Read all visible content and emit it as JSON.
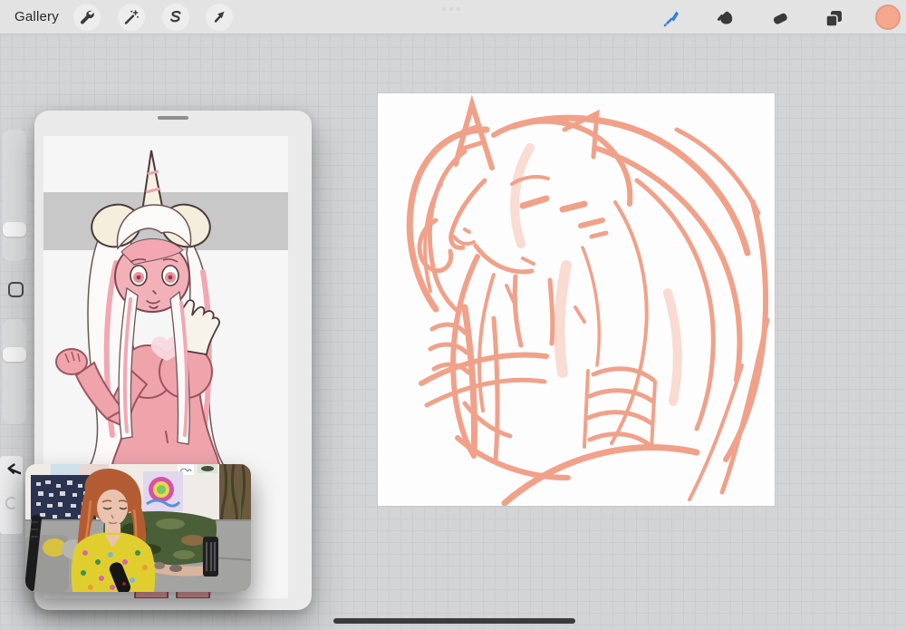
{
  "colors": {
    "bar_bg": "#e3e3e4",
    "canvas_bg": "#d3d4d5",
    "grid_line": "#cbccce",
    "white_canvas": "#fdfdfe",
    "win_bg": "#eaeaeb",
    "accent": "#f5a88d",
    "brush_blue": "#2a7de2",
    "icon_dark": "#3a3a3c",
    "sketch": "#f1a189",
    "sketch_light": "#f7c6b6",
    "band": "#c8c8c9",
    "indicator": "#3b3b3d"
  },
  "topbar": {
    "gallery_label": "Gallery",
    "left_tools": [
      {
        "id": "actions",
        "icon": "wrench-icon"
      },
      {
        "id": "adjustments",
        "icon": "magic-wand-icon"
      },
      {
        "id": "selection",
        "icon": "s-curve-icon"
      },
      {
        "id": "transform",
        "icon": "arrow-cursor-icon"
      }
    ],
    "multitask_dots": 3,
    "right_tools": [
      {
        "id": "paint",
        "icon": "brush-icon",
        "active": true,
        "color": "#2a7de2"
      },
      {
        "id": "smudge",
        "icon": "smudge-finger-icon",
        "active": false
      },
      {
        "id": "erase",
        "icon": "eraser-icon",
        "active": false
      },
      {
        "id": "layers",
        "icon": "layers-icon",
        "active": false
      },
      {
        "id": "color",
        "icon": "color-swatch-circle",
        "value": "#f5a88d"
      }
    ]
  },
  "sidebar": {
    "brush_size_percent": 70,
    "brush_opacity_percent": 73,
    "modify_button": true,
    "undo_arrow": true,
    "redo_arrow_dimmed": true
  },
  "canvas": {
    "sketch_color": "#f1a189",
    "content": "loose salmon sketch of horned unicorn character with flowing hair, closed eyes, raised arm and wrapped forearm"
  },
  "reference_window": {
    "drag_handle": true,
    "image_content": "finished illustration of pink anthro unicorn character with cream ears, striped horn, white-pink hair, hand raised to mouth, heart on chest",
    "band_color": "#c8c8c9"
  },
  "webcam_overlay": {
    "content": "streamer with curly red hair and yellow floral shirt on gray couch, dark collage poster and tie-dye poster on wall, camo blanket, black microphone, tattooed arm holding black can"
  },
  "home_indicator": {
    "visible": true
  }
}
